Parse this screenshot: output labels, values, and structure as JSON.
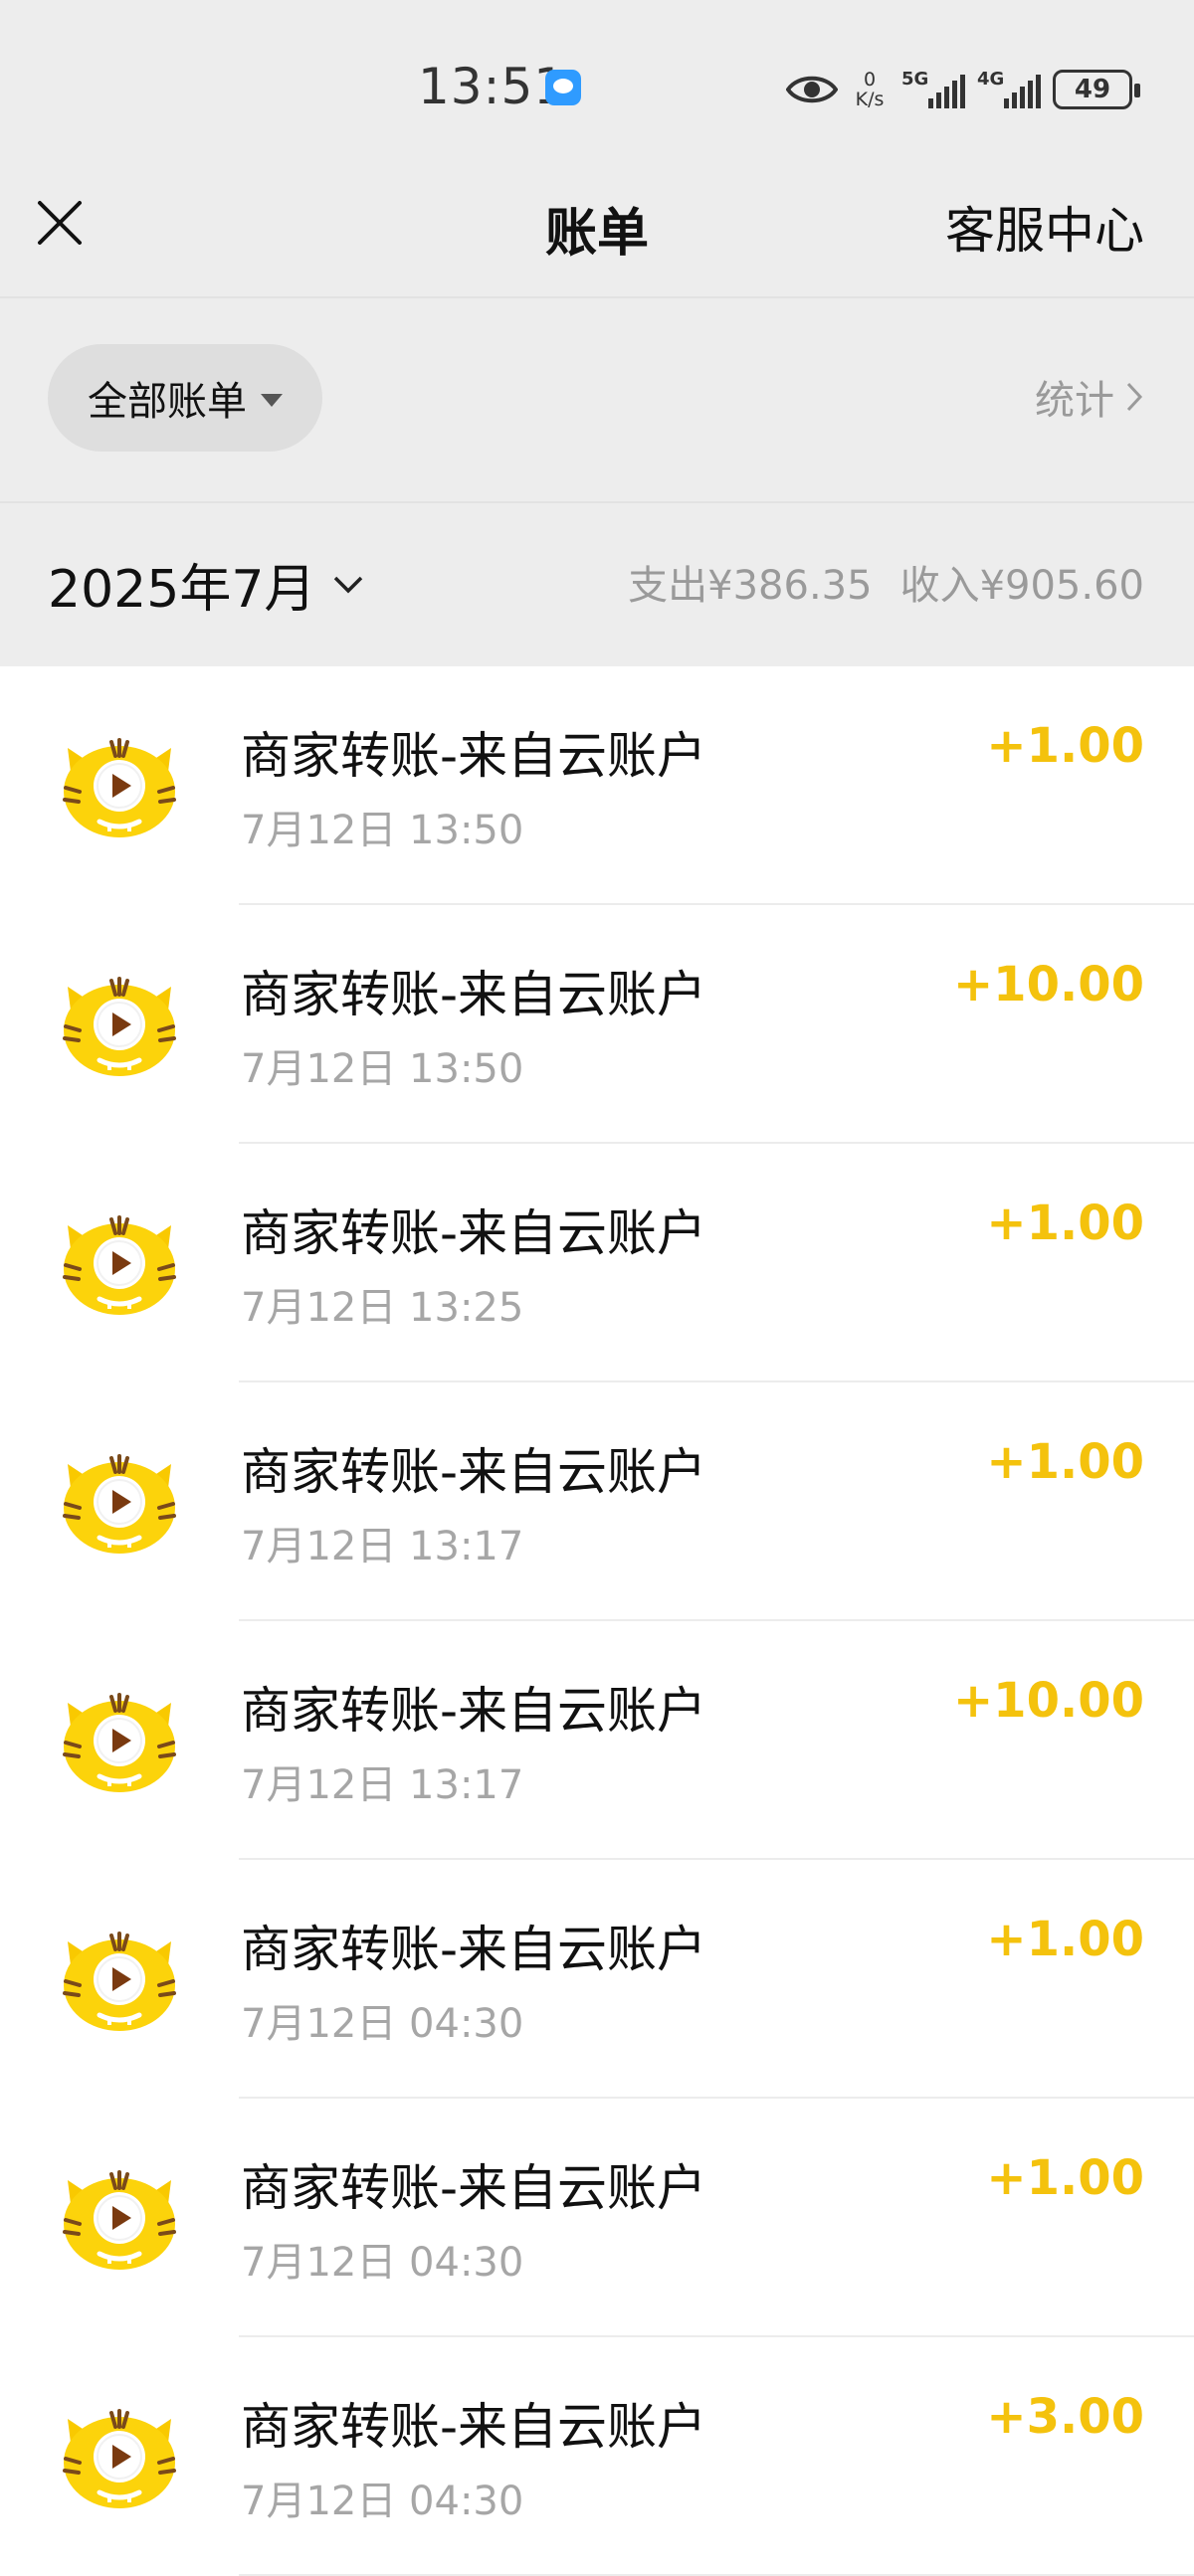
{
  "status_bar": {
    "time": "13:51",
    "net_speed_value": "0",
    "net_speed_unit": "K/s",
    "signal_1": "5G",
    "signal_2": "4G",
    "battery": "49"
  },
  "nav": {
    "title": "账单",
    "right_link": "客服中心",
    "close_icon": "close-icon"
  },
  "filter": {
    "label": "全部账单",
    "stats_label": "统计"
  },
  "month": {
    "label": "2025年7月",
    "expense": "支出¥386.35",
    "income": "收入¥905.60"
  },
  "colors": {
    "accent": "#f4c20d",
    "background": "#ededed"
  },
  "transactions": [
    {
      "title": "商家转账-来自云账户",
      "time": "7月12日 13:50",
      "amount": "+1.00"
    },
    {
      "title": "商家转账-来自云账户",
      "time": "7月12日 13:50",
      "amount": "+10.00"
    },
    {
      "title": "商家转账-来自云账户",
      "time": "7月12日 13:25",
      "amount": "+1.00"
    },
    {
      "title": "商家转账-来自云账户",
      "time": "7月12日 13:17",
      "amount": "+1.00"
    },
    {
      "title": "商家转账-来自云账户",
      "time": "7月12日 13:17",
      "amount": "+10.00"
    },
    {
      "title": "商家转账-来自云账户",
      "time": "7月12日 04:30",
      "amount": "+1.00"
    },
    {
      "title": "商家转账-来自云账户",
      "time": "7月12日 04:30",
      "amount": "+1.00"
    },
    {
      "title": "商家转账-来自云账户",
      "time": "7月12日 04:30",
      "amount": "+3.00"
    }
  ]
}
